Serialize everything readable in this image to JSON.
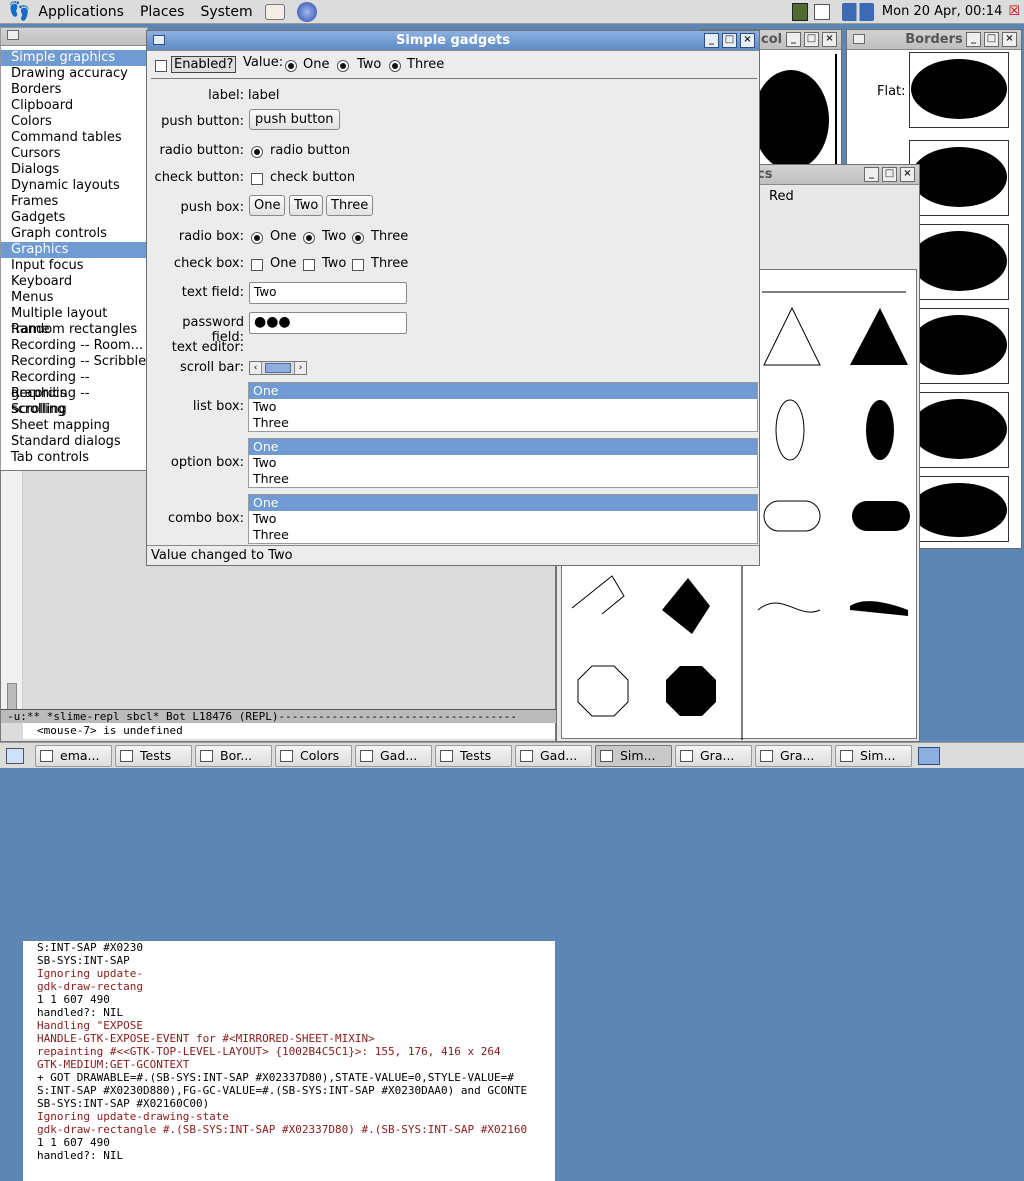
{
  "top_panel": {
    "menus": [
      "Applications",
      "Places",
      "System"
    ],
    "clock": "Mon 20 Apr, 00:14"
  },
  "selector_window": {
    "items": [
      "Simple graphics",
      "Drawing accuracy",
      "Borders",
      "Clipboard",
      "Colors",
      "Command tables",
      "Cursors",
      "Dialogs",
      "Dynamic layouts",
      "Frames",
      "Gadgets",
      "Graph controls",
      "Graphics",
      "Input focus",
      "Keyboard",
      "Menus",
      "Multiple layout frame",
      "Random rectangles",
      "Recording -- Room...",
      "Recording -- Scribble",
      "Recording -- graphics",
      "Recording -- scrolling",
      "Scrolling",
      "Sheet mapping",
      "Standard dialogs",
      "Tab controls"
    ],
    "selected": [
      0,
      12
    ]
  },
  "gadgets": {
    "title": "Simple gadgets",
    "enabled_label": "Enabled?",
    "value_label": "Value:",
    "value_options": [
      "One",
      "Two",
      "Three"
    ],
    "label_row": {
      "label": "label:",
      "value": "label"
    },
    "push_button": {
      "label": "push button:",
      "button": "push button"
    },
    "radio_button": {
      "label": "radio button:",
      "text": "radio button"
    },
    "check_button": {
      "label": "check button:",
      "text": "check button"
    },
    "push_box": {
      "label": "push box:",
      "buttons": [
        "One",
        "Two",
        "Three"
      ]
    },
    "radio_box": {
      "label": "radio box:",
      "options": [
        "One",
        "Two",
        "Three"
      ]
    },
    "check_box": {
      "label": "check box:",
      "options": [
        "One",
        "Two",
        "Three"
      ]
    },
    "text_field": {
      "label": "text field:",
      "value": "Two"
    },
    "password_field": {
      "label": "password field:",
      "value": "●●●"
    },
    "text_editor": {
      "label": "text editor:"
    },
    "scroll_bar": {
      "label": "scroll bar:"
    },
    "list_box": {
      "label": "list box:",
      "items": [
        "One",
        "Two",
        "Three"
      ]
    },
    "option_box": {
      "label": "option box:",
      "items": [
        "One",
        "Two",
        "Three"
      ]
    },
    "combo_box": {
      "label": "combo box:",
      "items": [
        "One",
        "Two",
        "Three"
      ]
    },
    "status": "Value changed to Two"
  },
  "borders_window": {
    "title": "Borders",
    "flat_label": "Flat:"
  },
  "colors_window": {
    "title_fragment": "col"
  },
  "graphics_window": {
    "title_fragment": "cs",
    "red_label": "Red"
  },
  "terminal": {
    "lines": [
      "S:INT-SAP #X0230",
      "SB-SYS:INT-SAP",
      "Ignoring update-",
      "gdk-draw-rectang",
      "1 1 607 490",
      "  handled?: NIL",
      "Handling \"EXPOSE",
      "HANDLE-GTK-EXPOSE-EVENT for #<MIRRORED-SHEET-MIXIN>",
      "repainting #<<GTK-TOP-LEVEL-LAYOUT> {1002B4C5C1}>: 155, 176, 416 x 264",
      "GTK-MEDIUM:GET-GCONTEXT",
      "  + GOT DRAWABLE=#.(SB-SYS:INT-SAP #X02337D80),STATE-VALUE=0,STYLE-VALUE=#",
      "S:INT-SAP #X0230D880),FG-GC-VALUE=#.(SB-SYS:INT-SAP #X0230DAA0) and GCONTE",
      "SB-SYS:INT-SAP #X02160C00)",
      "Ignoring update-drawing-state",
      "gdk-draw-rectangle #.(SB-SYS:INT-SAP #X02337D80) #.(SB-SYS:INT-SAP #X02160",
      "1 1 607 490",
      "  handled?: NIL"
    ],
    "modeline": "-u:**  *slime-repl sbcl*   Bot L18476  (REPL)------------------------------------",
    "minibuffer": "<mouse-7> is undefined"
  },
  "taskbar": [
    "ema...",
    "Tests",
    "Bor...",
    "Colors",
    "Gad...",
    "Tests",
    "Gad...",
    "Sim...",
    "Gra...",
    "Gra...",
    "Sim..."
  ],
  "taskbar_active": 7
}
